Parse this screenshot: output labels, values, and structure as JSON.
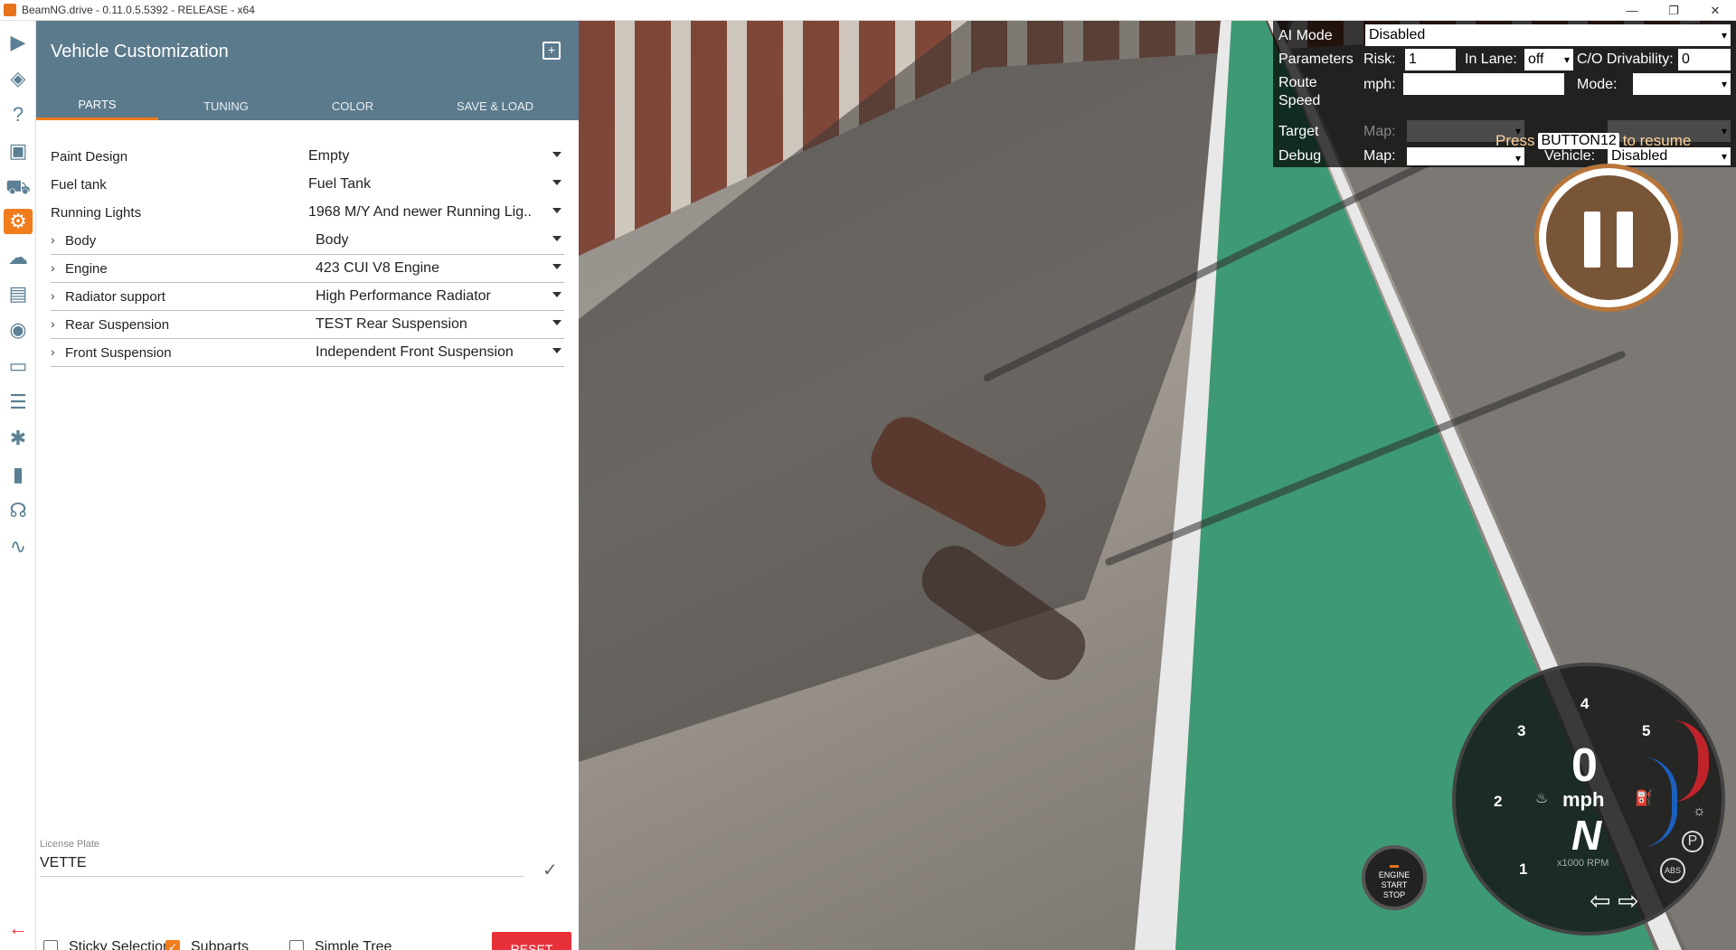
{
  "window": {
    "title": "BeamNG.drive - 0.11.0.5.5392 - RELEASE - x64",
    "controls": [
      "—",
      "❐",
      "✕"
    ]
  },
  "sidebar": {
    "icons": [
      "play-icon",
      "layers-icon",
      "help-icon",
      "mission-icon",
      "vehicle-icon",
      "vehicle-config-icon",
      "environment-icon",
      "film-icon",
      "camera-icon",
      "ui-apps-icon",
      "settings-sliders-icon",
      "bug-icon",
      "stats-icon",
      "headset-icon",
      "route-icon"
    ],
    "active": "vehicle-config-icon"
  },
  "panel": {
    "title": "Vehicle Customization",
    "tabs": [
      "PARTS",
      "TUNING",
      "COLOR",
      "SAVE & LOAD"
    ],
    "active_tab": "PARTS",
    "parts": [
      {
        "label": "Paint Design",
        "value": "Empty",
        "expandable": false
      },
      {
        "label": "Fuel tank",
        "value": "Fuel Tank",
        "expandable": false
      },
      {
        "label": "Running Lights",
        "value": "1968 M/Y And newer Running Lig..",
        "expandable": false
      },
      {
        "label": "Body",
        "value": "Body",
        "expandable": true
      },
      {
        "label": "Engine",
        "value": "423 CUI V8 Engine",
        "expandable": true
      },
      {
        "label": "Radiator support",
        "value": "High Performance Radiator",
        "expandable": true
      },
      {
        "label": "Rear Suspension",
        "value": "TEST Rear Suspension",
        "expandable": true
      },
      {
        "label": "Front Suspension",
        "value": "Independent Front Suspension",
        "expandable": true
      }
    ],
    "license_label": "License Plate",
    "license_value": "VETTE",
    "sticky_label": "Sticky Selection",
    "subparts_label": "Subparts",
    "simple_tree_label": "Simple Tree",
    "reset_label": "RESET",
    "sticky_checked": false,
    "subparts_checked": true,
    "simple_tree_checked": false
  },
  "ai": {
    "mode_label": "AI Mode",
    "mode_value": "Disabled",
    "params_label": "Parameters",
    "risk_label": "Risk:",
    "risk_value": "1",
    "inlane_label": "In Lane:",
    "inlane_value": "off",
    "co_label": "C/O Drivability:",
    "co_value": "0",
    "route_label": "Route",
    "speed_label": "Speed",
    "mph_label": "mph:",
    "mph_value": "",
    "modefield_label": "Mode:",
    "target_label": "Target",
    "map_label": "Map:",
    "debug_label": "Debug",
    "map2_label": "Map:",
    "vehicle_label": "Vehicle:",
    "vehicle_value": "Disabled"
  },
  "resume": {
    "press": "Press",
    "button": "BUTTON12",
    "to_resume": "to resume"
  },
  "gauge": {
    "speed": "0",
    "unit": "mph",
    "gear": "N",
    "rpm_label": "x1000 RPM",
    "ticks": [
      "1",
      "2",
      "3",
      "4",
      "5"
    ]
  },
  "engine_button": {
    "line1": "ENGINE",
    "line2": "START",
    "line3": "STOP"
  },
  "colors": {
    "accent": "#f07c1b",
    "header": "#5b7a8c",
    "reset": "#e8303a"
  }
}
